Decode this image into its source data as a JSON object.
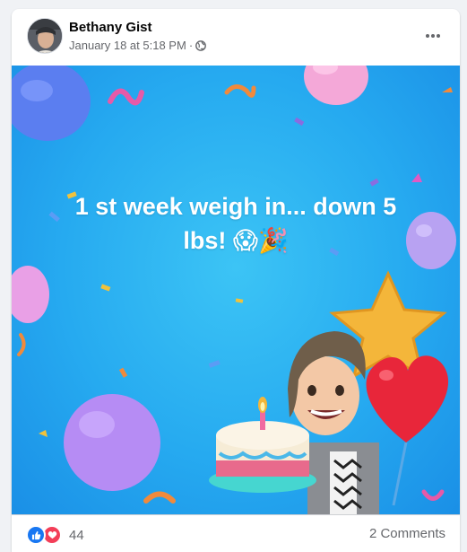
{
  "post": {
    "author": "Bethany Gist",
    "timestamp": "January 18 at 5:18 PM",
    "separator": "·",
    "privacy_icon": "globe-icon",
    "options_icon": "more-dots-icon",
    "text_line1": "1 st week weigh in... down 5",
    "text_line2": "lbs! 😱🎉"
  },
  "reactions": {
    "icons": [
      "like-icon",
      "love-icon"
    ],
    "count": "44",
    "comments": "2 Comments"
  },
  "colors": {
    "accent": "#1877f2",
    "love": "#f33e58",
    "background_top": "#3cc4f5",
    "background_edge": "#1a8fe6"
  }
}
